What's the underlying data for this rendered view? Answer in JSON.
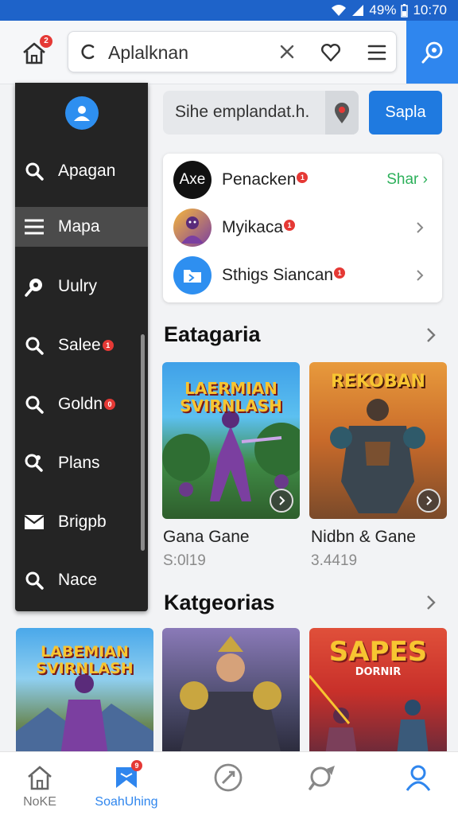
{
  "status_bar": {
    "battery": "49%",
    "time": "10:70"
  },
  "top_bar": {
    "home_badge": "2",
    "search_query": "Aplalknan"
  },
  "drawer": {
    "items": [
      {
        "label": "Apagan",
        "icon": "search-icon",
        "badge": ""
      },
      {
        "label": "Mapa",
        "icon": "menu-icon",
        "badge": ""
      },
      {
        "label": "Uulry",
        "icon": "pin-icon",
        "badge": ""
      },
      {
        "label": "Salee",
        "icon": "search-icon",
        "badge": "1"
      },
      {
        "label": "Goldn",
        "icon": "search-icon",
        "badge": "0"
      },
      {
        "label": "Plans",
        "icon": "search-people-icon",
        "badge": ""
      },
      {
        "label": "Brigpb",
        "icon": "mail-icon",
        "badge": ""
      },
      {
        "label": "Nace",
        "icon": "search-icon",
        "badge": ""
      }
    ]
  },
  "search_panel": {
    "input_text": "Sihe emplandat.h.",
    "button_label": "Sapla"
  },
  "list": {
    "items": [
      {
        "icon_text": "Axe",
        "label": "Penacken",
        "badge": "1",
        "action": "Shar"
      },
      {
        "label": "Myikaca",
        "badge": "1",
        "action": ""
      },
      {
        "label": "Sthigs Siancan",
        "badge": "1",
        "action": ""
      }
    ]
  },
  "section1": {
    "title": "Eatagaria",
    "tiles": [
      {
        "art_text": "LAERMIAN SVIRNLASH",
        "title": "Gana Gane",
        "subtitle": "S:0l19"
      },
      {
        "art_text": "REKOBAN",
        "title": "Nidbn & Gane",
        "subtitle": "3.4419"
      }
    ]
  },
  "section2": {
    "title": "Katgeorias",
    "tiles": [
      {
        "art_text": "LABEMIAN SVIRNLASH"
      },
      {
        "art_text": ""
      },
      {
        "art_text": "SAPES",
        "art_sub": "DORNIR"
      }
    ]
  },
  "bottom_nav": {
    "items": [
      {
        "label": "NoKE",
        "icon": "home-icon"
      },
      {
        "label": "SoahUhing",
        "icon": "bookmark-chat-icon",
        "badge": "9"
      },
      {
        "label": "",
        "icon": "compass-icon"
      },
      {
        "label": "",
        "icon": "tag-icon"
      },
      {
        "label": "",
        "icon": "profile-icon"
      }
    ]
  },
  "colors": {
    "accent": "#2f86ee",
    "status_bar": "#1e63c9",
    "drawer": "#242424",
    "badge": "#e53935",
    "action_green": "#2cb05a"
  }
}
